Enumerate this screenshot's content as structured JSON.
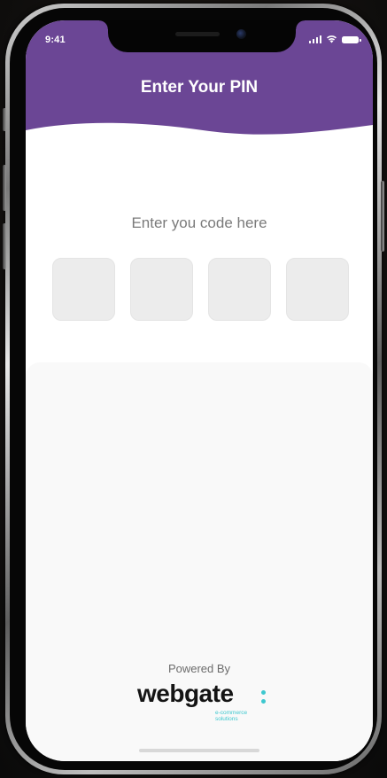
{
  "status_bar": {
    "time": "9:41",
    "icons": [
      "cellular-signal-icon",
      "wifi-icon",
      "battery-icon"
    ]
  },
  "header": {
    "title": "Enter Your PIN",
    "color": "#6b4695"
  },
  "pin_entry": {
    "prompt": "Enter you code here",
    "digits": [
      "",
      "",
      "",
      ""
    ]
  },
  "footer": {
    "powered_by": "Powered By",
    "logo_text": "webgate",
    "logo_tagline": "e-commerce solutions",
    "logo_accent": "#3dc8cf"
  }
}
